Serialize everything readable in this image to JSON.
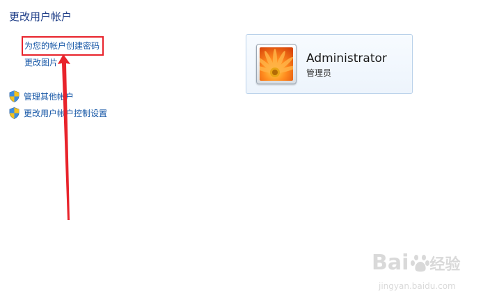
{
  "page": {
    "title": "更改用户帐户"
  },
  "tasks": {
    "create_password": "为您的帐户创建密码",
    "change_picture": "更改图片"
  },
  "admin_tasks": [
    {
      "label": "管理其他帐户",
      "icon": "shield-icon"
    },
    {
      "label": "更改用户帐户控制设置",
      "icon": "shield-icon"
    }
  ],
  "user": {
    "name": "Administrator",
    "role": "管理员",
    "avatar": "orange-flower-picture"
  },
  "annotation": {
    "highlight_color": "#e8232b",
    "arrow_color": "#e8232b"
  },
  "watermark": {
    "brand": "Bai",
    "brand_suffix": "经验",
    "url": "jingyan.baidu.com"
  },
  "colors": {
    "link": "#1556a6",
    "title": "#1e3d87",
    "card_border": "#b9d1ea"
  }
}
